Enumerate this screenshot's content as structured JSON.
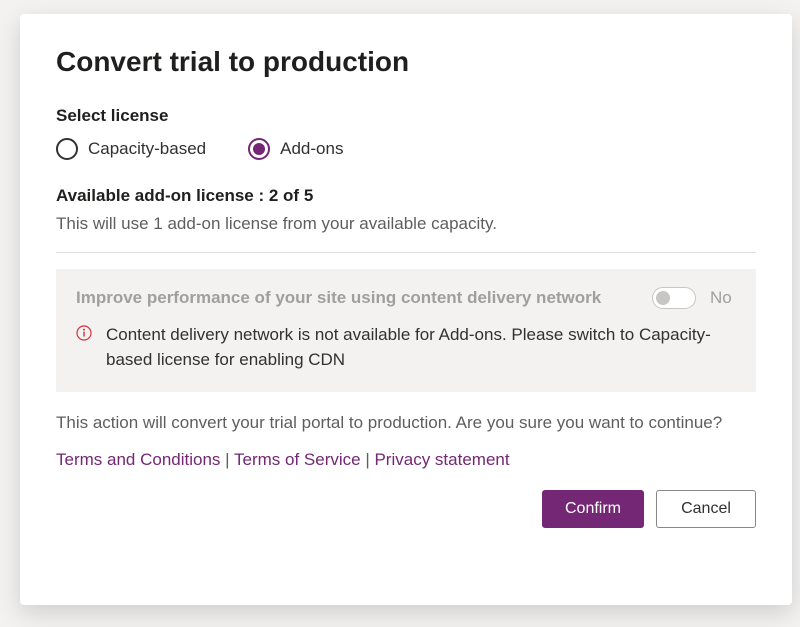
{
  "dialog": {
    "title": "Convert trial to production",
    "select_license_label": "Select license",
    "radio": {
      "capacity_based": "Capacity-based",
      "add_ons": "Add-ons",
      "selected": "add_ons"
    },
    "available_license_label": "Available add-on license : 2 of 5",
    "license_usage_text": "This will use 1 add-on license from your available capacity.",
    "cdn": {
      "label": "Improve performance of your site using content delivery network",
      "state": "No",
      "warning": "Content delivery network is not available for Add-ons. Please switch to Capacity-based license for enabling CDN"
    },
    "confirm_text": "This action will convert your trial portal to production. Are you sure you want to continue?",
    "links": {
      "terms_conditions": "Terms and Conditions",
      "terms_service": "Terms of Service",
      "privacy": "Privacy statement"
    },
    "buttons": {
      "confirm": "Confirm",
      "cancel": "Cancel"
    }
  }
}
